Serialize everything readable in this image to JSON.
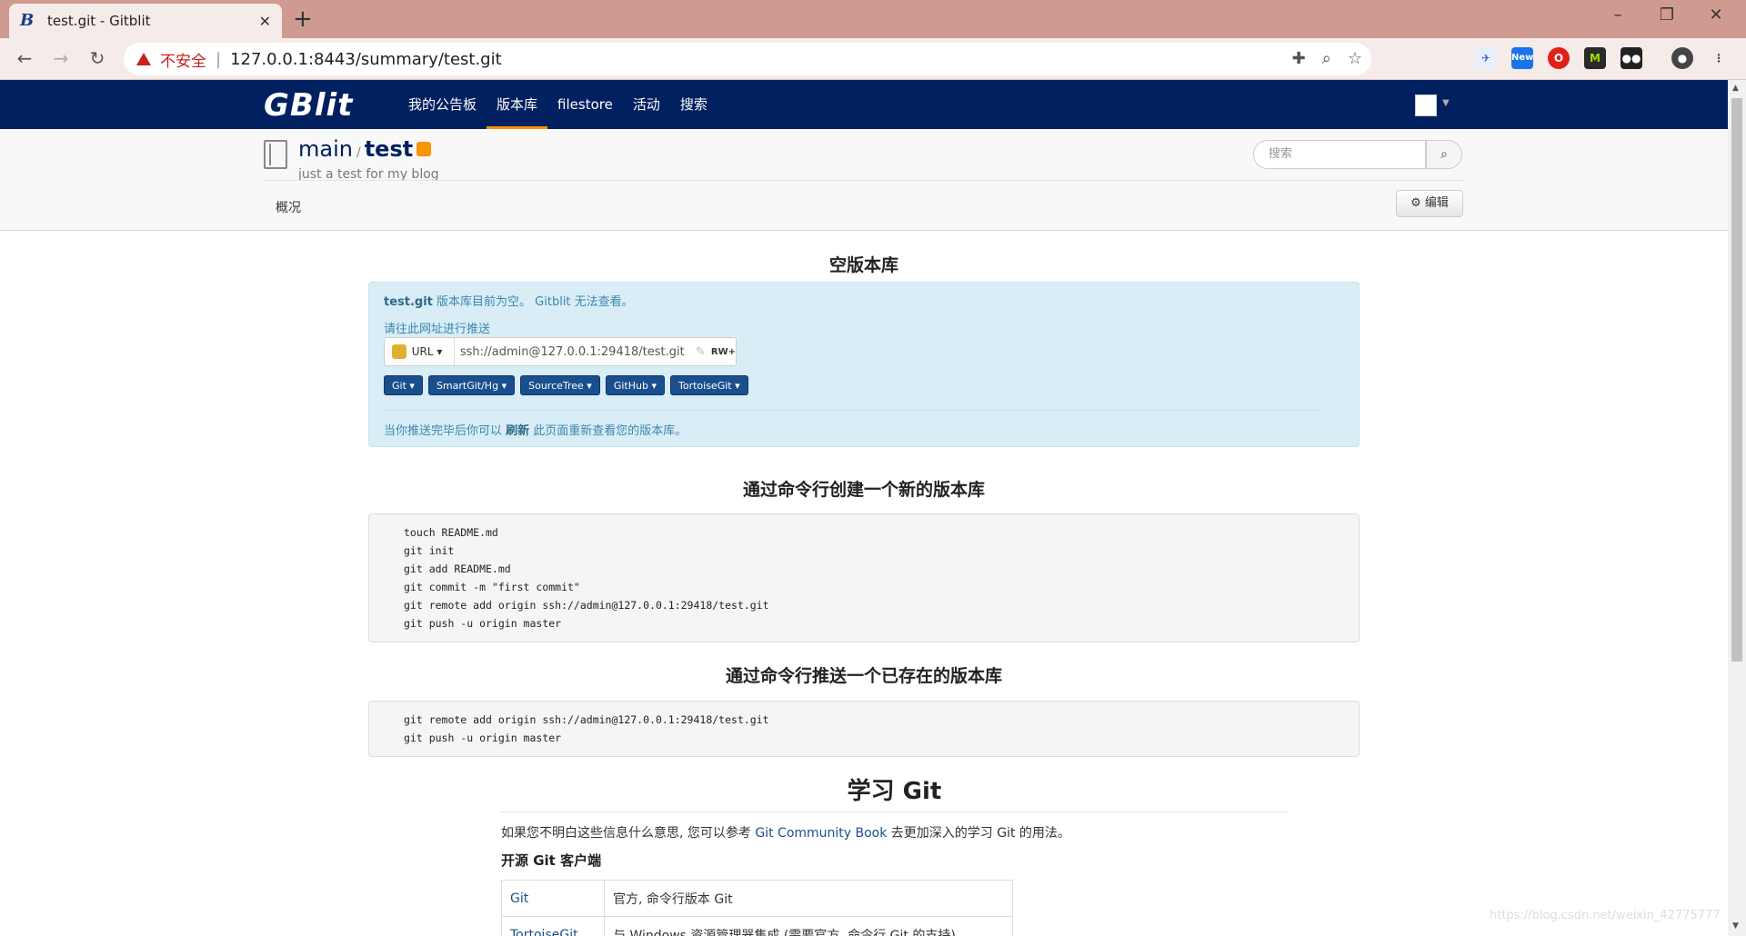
{
  "browser": {
    "tab_title": "test.git - Gitblit",
    "tab_favicon": "B",
    "new_tab": "+",
    "insecure_label": "不安全",
    "separator": "|",
    "url": "127.0.0.1:8443/summary/test.git",
    "ext_new_badge": "New",
    "ext_m": "M"
  },
  "gitblit": {
    "logo": "GBlit",
    "menu": [
      "我的公告板",
      "版本库",
      "filestore",
      "活动",
      "搜索"
    ],
    "active_menu": "版本库",
    "repo_project": "main",
    "repo_sep": "/",
    "repo_name": "test",
    "repo_description": "just a test for my blog",
    "search_placeholder": "搜索",
    "tab_overview": "概况",
    "edit_button": "编辑"
  },
  "empty_repo": {
    "heading": "空版本库",
    "repo_file": "test.git",
    "message_rest": " 版本库目前为空。 Gitblit 无法查看。",
    "push_hint": "请往此网址进行推送",
    "url_protocol": "URL",
    "clone_url": "ssh://admin@127.0.0.1:29418/test.git",
    "permission": "RW+",
    "clients": [
      "Git",
      "SmartGit/Hg",
      "SourceTree",
      "GitHub",
      "TortoiseGit"
    ],
    "refresh_prefix": "当你推送完毕后你可以 ",
    "refresh_word": "刷新",
    "refresh_suffix": " 此页面重新查看您的版本库。"
  },
  "create_section": {
    "heading": "通过命令行创建一个新的版本库",
    "lines": [
      "touch README.md",
      "git init",
      "git add README.md",
      "git commit -m \"first commit\"",
      "git remote add origin ssh://admin@127.0.0.1:29418/test.git",
      "git push -u origin master"
    ]
  },
  "push_section": {
    "heading": "通过命令行推送一个已存在的版本库",
    "lines": [
      "git remote add origin ssh://admin@127.0.0.1:29418/test.git",
      "git push -u origin master"
    ]
  },
  "learn": {
    "heading": "学习 Git",
    "text_prefix": "如果您不明白这些信息什么意思, 您可以参考 ",
    "link": "Git Community Book",
    "text_suffix": " 去更加深入的学习 Git 的用法。",
    "subheading": "开源 Git 客户端",
    "clients": [
      {
        "name": "Git",
        "desc": "官方, 命令行版本 Git"
      },
      {
        "name": "TortoiseGit",
        "desc": "与 Windows 资源管理器集成 (需要官方, 命令行 Git 的支持)"
      }
    ]
  },
  "watermark": "https://blog.csdn.net/weixin_42775777",
  "colors": {
    "navbar": "#002060",
    "accent": "#f89406",
    "alert_bg": "#d9edf7",
    "tabstrip": "#cf9a8f"
  }
}
